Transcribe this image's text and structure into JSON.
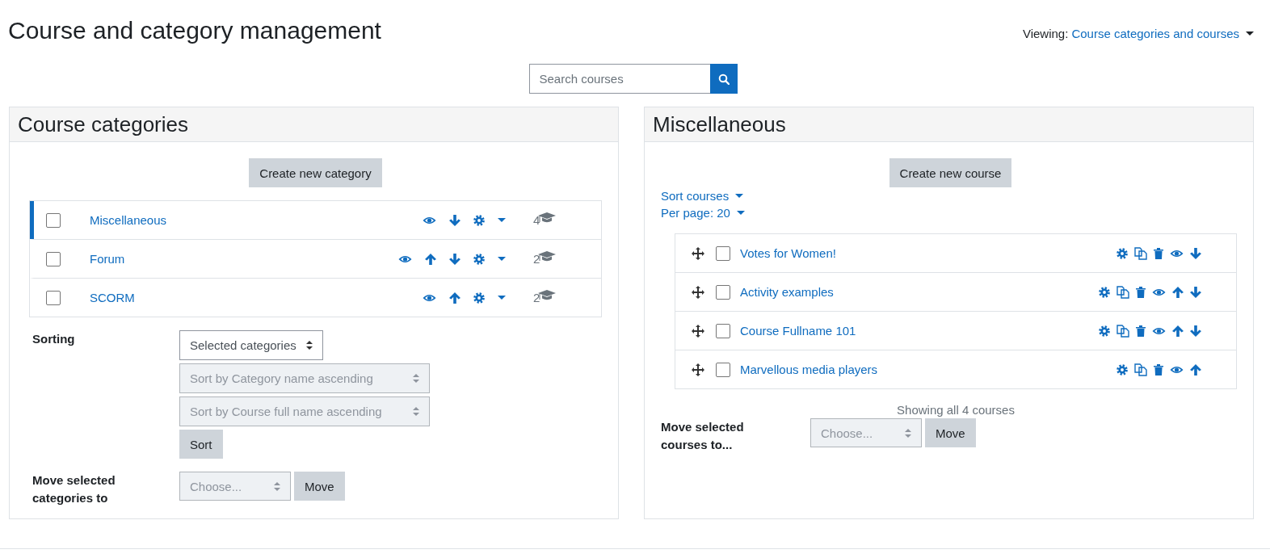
{
  "title": "Course and category management",
  "viewing": {
    "label": "Viewing:",
    "value": "Course categories and courses"
  },
  "search": {
    "placeholder": "Search courses"
  },
  "categories_panel": {
    "heading": "Course categories",
    "create_button": "Create new category",
    "categories": [
      {
        "name": "Miscellaneous",
        "selected": true,
        "checked": false,
        "actions": [
          {
            "kind": "show"
          },
          {
            "kind": "down"
          },
          {
            "kind": "settings"
          },
          {
            "kind": "menu"
          }
        ],
        "count": "4"
      },
      {
        "name": "Forum",
        "selected": false,
        "checked": false,
        "actions": [
          {
            "kind": "show"
          },
          {
            "kind": "up"
          },
          {
            "kind": "down"
          },
          {
            "kind": "settings"
          },
          {
            "kind": "menu"
          }
        ],
        "count": "2"
      },
      {
        "name": "SCORM",
        "selected": false,
        "checked": false,
        "actions": [
          {
            "kind": "show"
          },
          {
            "kind": "up"
          },
          {
            "kind": "settings"
          },
          {
            "kind": "menu"
          }
        ],
        "count": "2"
      }
    ],
    "sorting": {
      "label": "Sorting",
      "selects": [
        {
          "value": "Selected categories",
          "disabled": false
        },
        {
          "value": "Sort by Category name ascending",
          "disabled": true
        },
        {
          "value": "Sort by Course full name ascending",
          "disabled": true
        }
      ],
      "button": "Sort"
    },
    "move": {
      "label": "Move selected categories to",
      "select": {
        "value": "Choose...",
        "disabled": true
      },
      "button": "Move"
    }
  },
  "courses_panel": {
    "heading": "Miscellaneous",
    "create_button": "Create new course",
    "sort_link": "Sort courses",
    "per_page_link": "Per page: 20",
    "courses": [
      {
        "name": "Votes for Women!",
        "checked": false,
        "actions": [
          {
            "kind": "settings"
          },
          {
            "kind": "copy"
          },
          {
            "kind": "delete"
          },
          {
            "kind": "show"
          },
          {
            "kind": "down"
          }
        ]
      },
      {
        "name": "Activity examples",
        "checked": false,
        "actions": [
          {
            "kind": "settings"
          },
          {
            "kind": "copy"
          },
          {
            "kind": "delete"
          },
          {
            "kind": "show"
          },
          {
            "kind": "up"
          },
          {
            "kind": "down"
          }
        ]
      },
      {
        "name": "Course Fullname 101",
        "checked": false,
        "actions": [
          {
            "kind": "settings"
          },
          {
            "kind": "copy"
          },
          {
            "kind": "delete"
          },
          {
            "kind": "show"
          },
          {
            "kind": "up"
          },
          {
            "kind": "down"
          }
        ]
      },
      {
        "name": "Marvellous media players",
        "checked": false,
        "actions": [
          {
            "kind": "settings"
          },
          {
            "kind": "copy"
          },
          {
            "kind": "delete"
          },
          {
            "kind": "show"
          },
          {
            "kind": "up"
          }
        ]
      }
    ],
    "summary": "Showing all 4 courses",
    "move": {
      "label": "Move selected courses to...",
      "select": {
        "value": "Choose...",
        "disabled": true
      },
      "button": "Move"
    }
  }
}
